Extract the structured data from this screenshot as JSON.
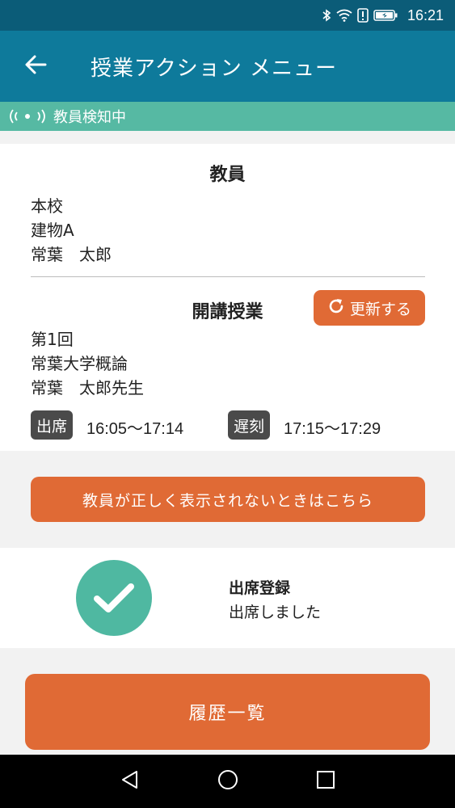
{
  "status_bar": {
    "time": "16:21",
    "icons": [
      "bluetooth-icon",
      "wifi-icon",
      "alert-icon",
      "battery-icon"
    ]
  },
  "app_bar": {
    "title": "授業アクション メニュー",
    "back_icon": "arrow-left-icon"
  },
  "detect": {
    "label": "教員検知中",
    "icon": "signal-icon"
  },
  "teacher": {
    "section_title": "教員",
    "campus": "本校",
    "building": "建物A",
    "name": "常葉　太郎"
  },
  "lecture": {
    "section_title": "開講授業",
    "refresh_label": "更新する",
    "session": "第1回",
    "course": "常葉大学概論",
    "instructor": "常葉　太郎先生",
    "attend_tag": "出席",
    "attend_time": "16:05〜17:14",
    "late_tag": "遅刻",
    "late_time": "17:15〜17:29"
  },
  "help_button_label": "教員が正しく表示されないときはこちら",
  "attendance": {
    "title": "出席登録",
    "status": "出席しました",
    "icon": "check-icon"
  },
  "history_button_label": "履歴一覧",
  "colors": {
    "status_bar": "#0b5c78",
    "app_bar": "#0e7a9b",
    "detect_strip": "#56b9a3",
    "accent_orange": "#e06a35",
    "check_green": "#4fb8a1",
    "tag_gray": "#4a4a4a"
  }
}
